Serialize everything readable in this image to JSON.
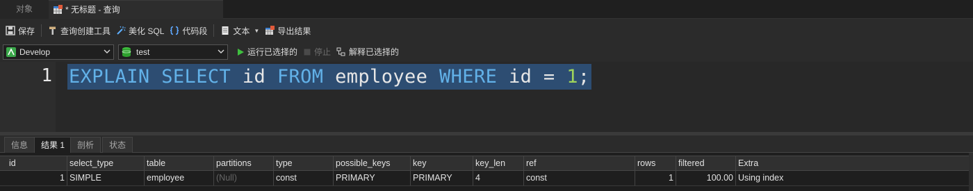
{
  "tabs": {
    "objects": "对象",
    "query": "* 无标题 - 查询"
  },
  "toolbar": {
    "save": "保存",
    "query_builder": "查询创建工具",
    "beautify_sql": "美化 SQL",
    "snippet": "代码段",
    "text": "文本",
    "export": "导出结果"
  },
  "connection": {
    "name": "Develop",
    "database": "test",
    "run_selected": "运行已选择的",
    "stop": "停止",
    "explain_selected": "解释已选择的"
  },
  "editor": {
    "line_number": "1",
    "tokens": {
      "explain": "EXPLAIN",
      "select": "SELECT",
      "col": "id",
      "from": "FROM",
      "table": "employee",
      "where": "WHERE",
      "col2": "id",
      "op": "=",
      "value": "1",
      "end": ";"
    }
  },
  "result_tabs": [
    "信息",
    "结果 1",
    "剖析",
    "状态"
  ],
  "grid": {
    "columns": [
      "id",
      "select_type",
      "table",
      "partitions",
      "type",
      "possible_keys",
      "key",
      "key_len",
      "ref",
      "rows",
      "filtered",
      "Extra"
    ],
    "row": [
      "1",
      "SIMPLE",
      "employee",
      "(Null)",
      "const",
      "PRIMARY",
      "PRIMARY",
      "4",
      "const",
      "1",
      "100.00",
      "Using index"
    ]
  },
  "colors": {
    "keyword": "#62b1e8",
    "number": "#9fd45b",
    "selection": "#2d4d72",
    "run_green": "#3fbf3f"
  }
}
